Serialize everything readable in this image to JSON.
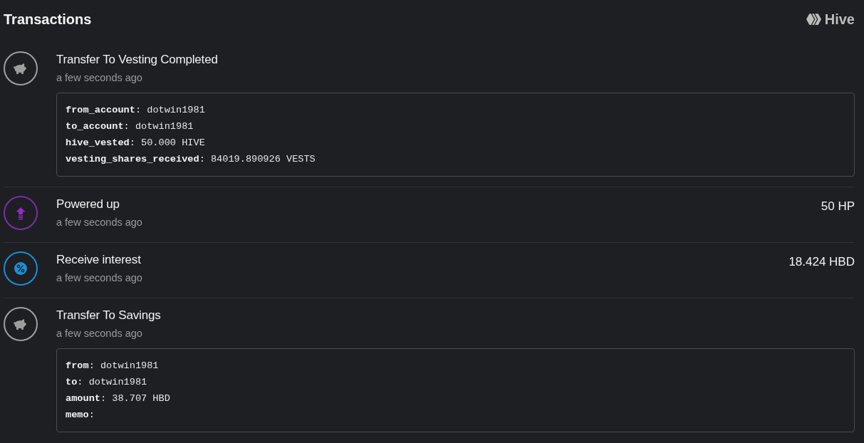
{
  "header": {
    "title": "Transactions",
    "brand": "Hive"
  },
  "transactions": [
    {
      "kind": "vesting",
      "title": "Transfer To Vesting Completed",
      "time": "a few seconds ago",
      "details": [
        "**from_account**: dotwin1981",
        "**to_account**: dotwin1981",
        "**hive_vested**: 50.000 HIVE",
        "**vesting_shares_received**: 84019.890926 VESTS"
      ]
    },
    {
      "kind": "power_up",
      "title": "Powered up",
      "time": "a few seconds ago",
      "amount": "50 HP"
    },
    {
      "kind": "interest",
      "title": "Receive interest",
      "time": "a few seconds ago",
      "amount": "18.424 HBD"
    },
    {
      "kind": "savings",
      "title": "Transfer To Savings",
      "time": "a few seconds ago",
      "details": [
        "**from**: dotwin1981",
        "**to**: dotwin1981",
        "**amount**: 38.707 HBD",
        "**memo**:"
      ]
    }
  ]
}
